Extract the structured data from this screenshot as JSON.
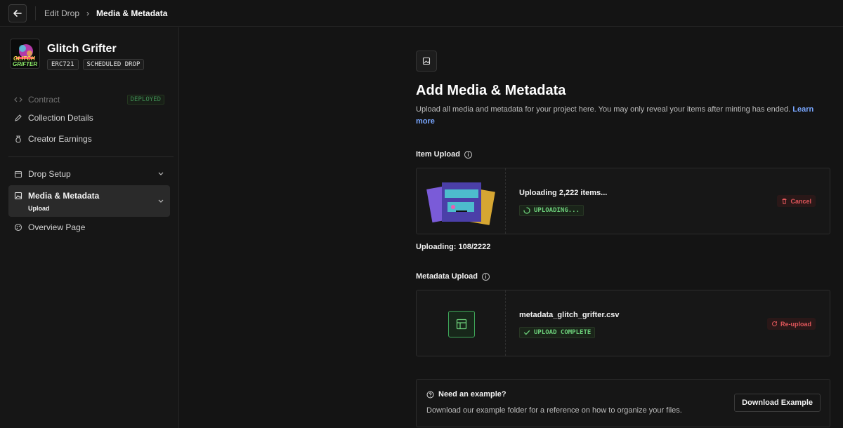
{
  "breadcrumb": {
    "parent": "Edit Drop",
    "separator": "›",
    "current": "Media & Metadata"
  },
  "collection": {
    "name": "Glitch Grifter",
    "logo_text_top": "GLITCH",
    "logo_text_bottom": "GRIFTER",
    "tags": [
      "ERC721",
      "SCHEDULED DROP"
    ]
  },
  "sidebar": {
    "items": [
      {
        "label": "Contract",
        "badge": "DEPLOYED",
        "icon": "code-icon"
      },
      {
        "label": "Collection Details",
        "icon": "pencil-icon"
      },
      {
        "label": "Creator Earnings",
        "icon": "money-bag-icon"
      },
      {
        "label": "Drop Setup",
        "icon": "calendar-icon"
      },
      {
        "label": "Media & Metadata",
        "sub": "Upload",
        "icon": "image-icon"
      },
      {
        "label": "Overview Page",
        "icon": "palette-icon"
      }
    ]
  },
  "main": {
    "title": "Add Media & Metadata",
    "description": "Upload all media and metadata for your project here. You may only reveal your items after minting has ended.",
    "learn_more": "Learn more",
    "item_upload": {
      "label": "Item Upload",
      "file_label": "Uploading 2,222 items...",
      "status": "UPLOADING...",
      "action": "Cancel",
      "progress_text": "Uploading: 108/2222",
      "uploaded": 108,
      "total": 2222
    },
    "metadata_upload": {
      "label": "Metadata Upload",
      "file_label": "metadata_glitch_grifter.csv",
      "status": "UPLOAD COMPLETE",
      "action": "Re-upload"
    },
    "example": {
      "title": "Need an example?",
      "description": "Download our example folder for a reference on how to organize your files.",
      "button": "Download Example"
    }
  },
  "colors": {
    "accent_link": "#78a6ff",
    "success": "#6ccf7a",
    "danger": "#e0565a",
    "deployed": "#3e8a52"
  }
}
